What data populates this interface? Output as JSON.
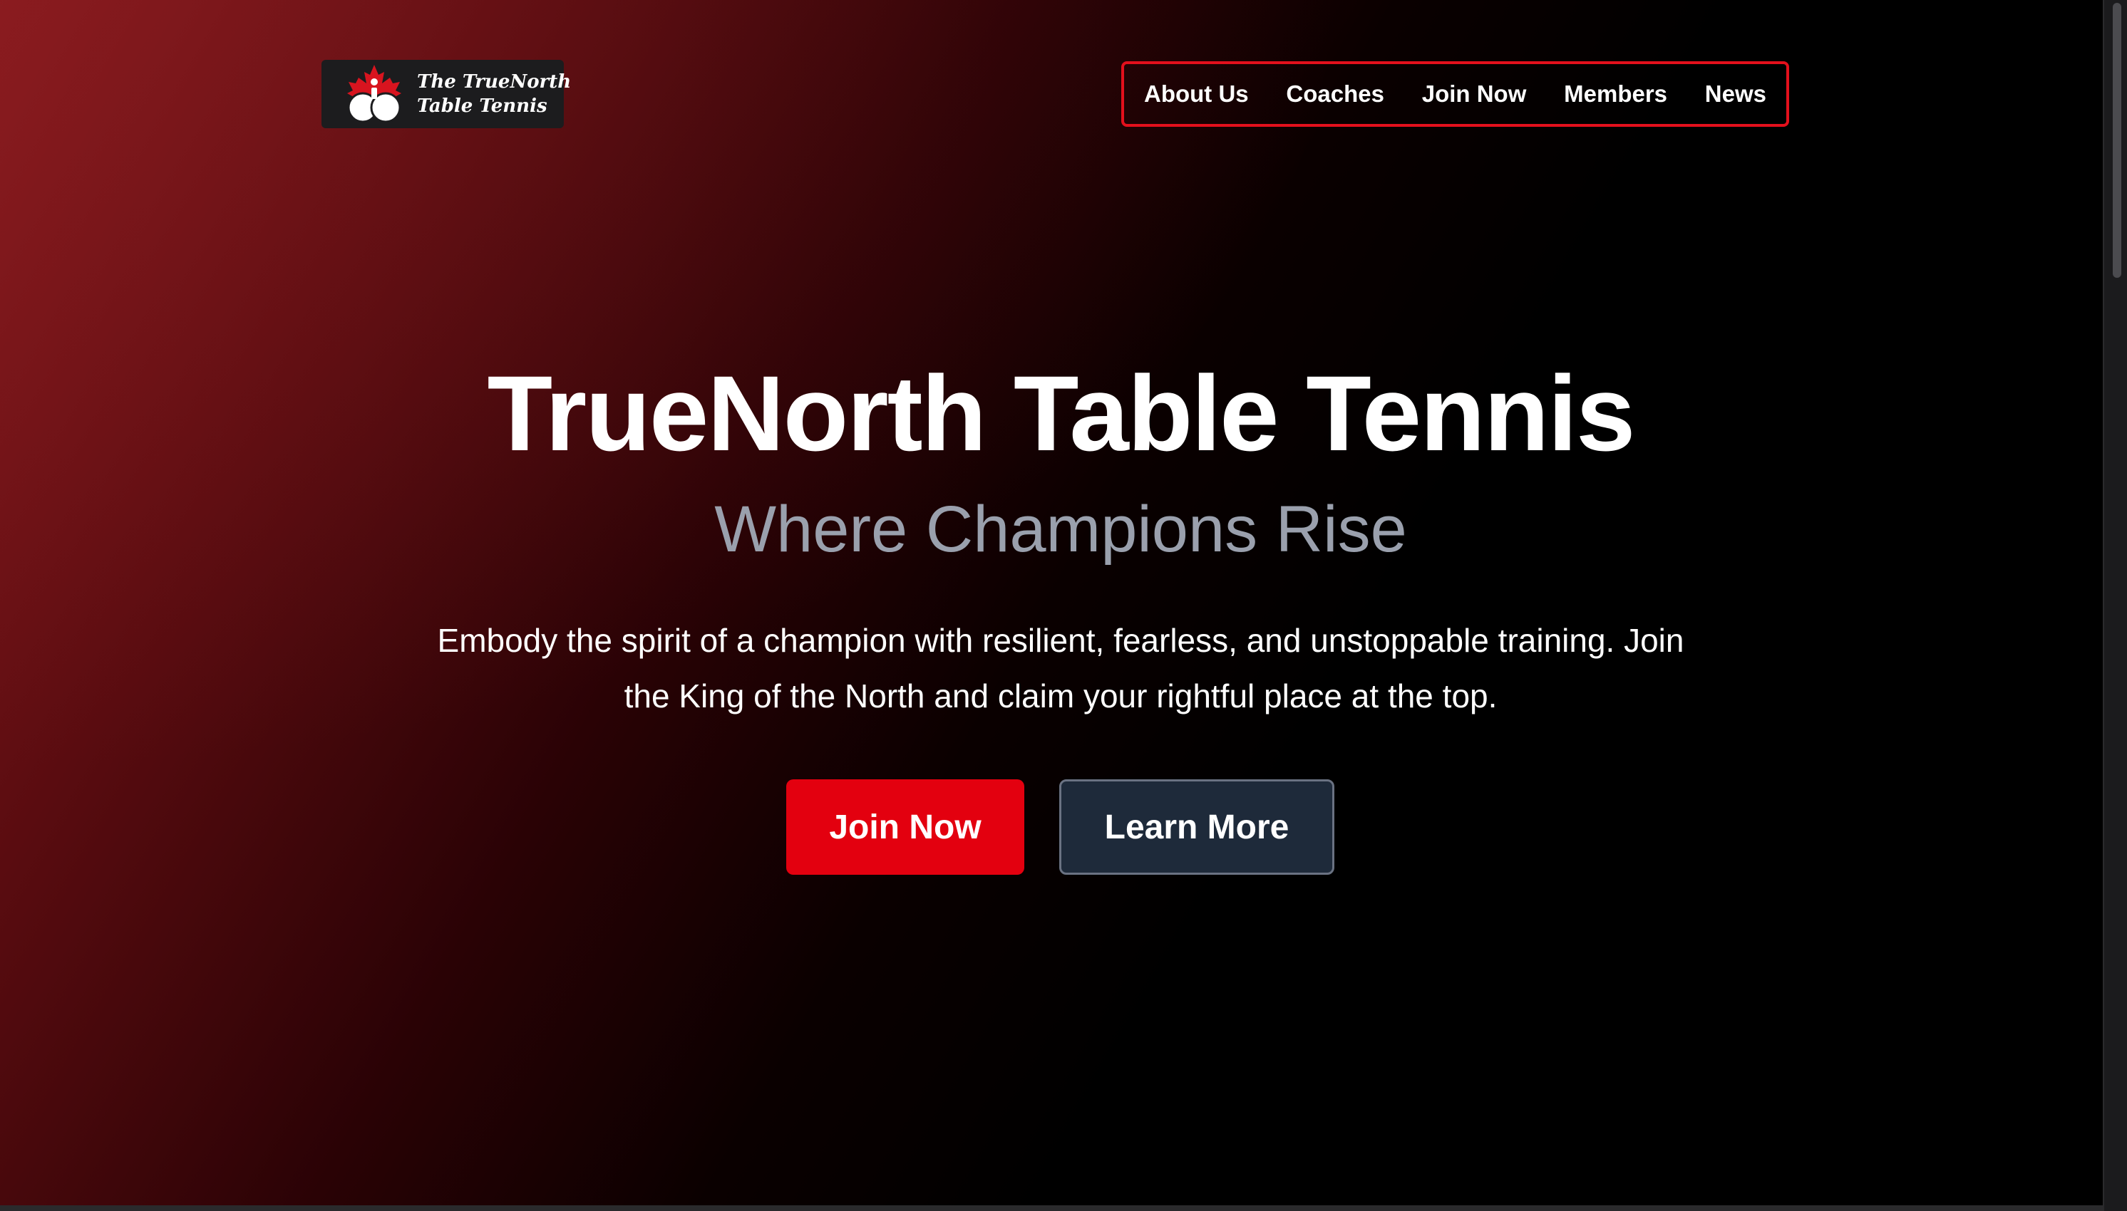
{
  "logo": {
    "line1": "The TrueNorth",
    "line2": "Table Tennis"
  },
  "nav": {
    "items": [
      {
        "label": "About Us"
      },
      {
        "label": "Coaches"
      },
      {
        "label": "Join Now"
      },
      {
        "label": "Members"
      },
      {
        "label": "News"
      }
    ]
  },
  "hero": {
    "title": "TrueNorth Table Tennis",
    "subtitle": "Where Champions Rise",
    "description": "Embody the spirit of a champion with resilient, fearless, and unstoppable training. Join the King of the North and claim your rightful place at the top.",
    "primary_button": "Join Now",
    "secondary_button": "Learn More"
  },
  "colors": {
    "accent": "#e3000f",
    "nav_border": "#e3101c",
    "subtitle": "#9aa0ad",
    "secondary_button_bg": "#1e2a3a",
    "background_start": "#8a1a1e",
    "background_end": "#000000"
  },
  "icons": {
    "logo_mark": "maple-leaf-paddles-icon"
  }
}
